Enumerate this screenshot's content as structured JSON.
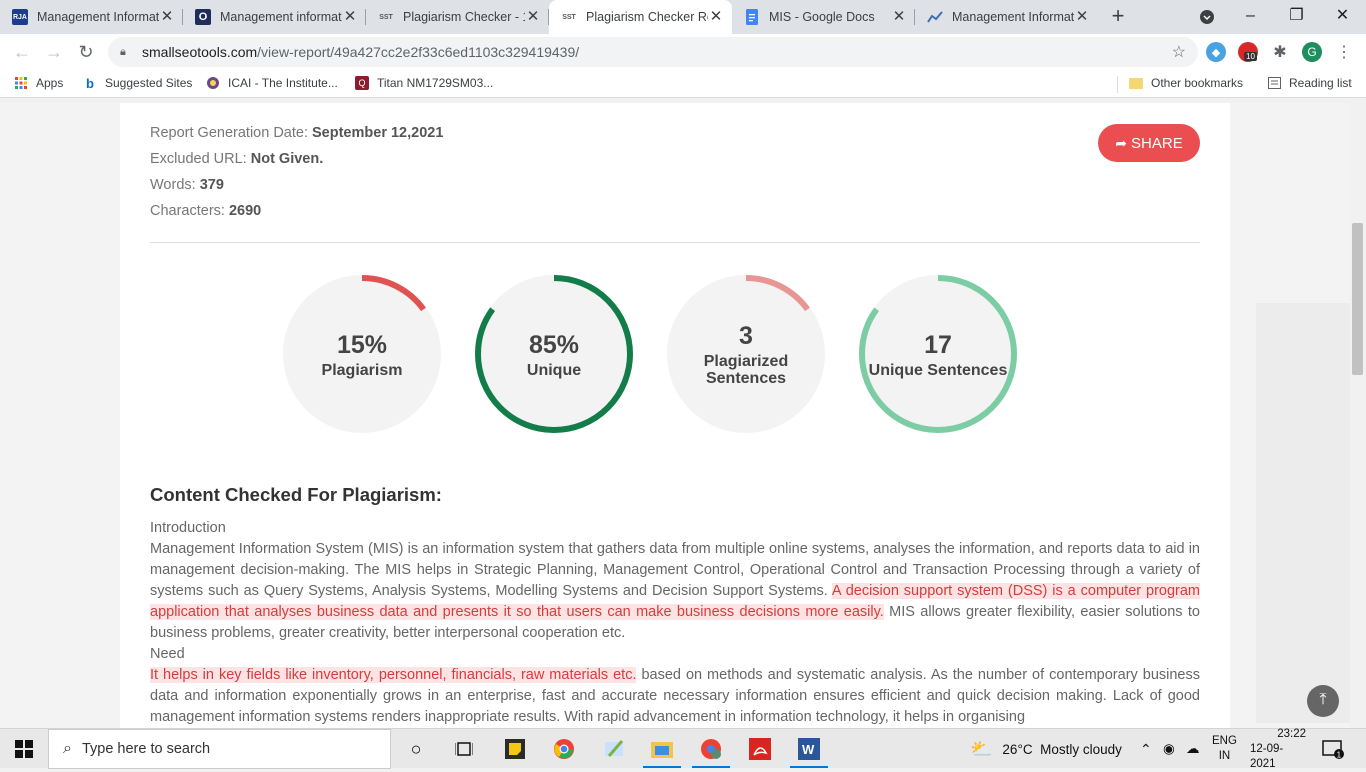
{
  "tabs": [
    {
      "title": "Management Informat",
      "favicon": "RJA",
      "fav_color": "#1c3c8c"
    },
    {
      "title": "Management informat",
      "favicon": "O",
      "fav_color": "#1f2d5a"
    },
    {
      "title": "Plagiarism Checker - 1",
      "favicon": "SST",
      "fav_color": "#ffffff"
    },
    {
      "title": "Plagiarism Checker Re",
      "favicon": "SST",
      "fav_color": "#ffffff"
    },
    {
      "title": "MIS - Google Docs",
      "favicon": "docs-icon",
      "fav_color": "#4285f4"
    },
    {
      "title": "Management Informat",
      "favicon": "chart-icon",
      "fav_color": "#ffffff"
    }
  ],
  "toolbar": {
    "url_host": "smallseotools.com",
    "url_path": "/view-report/49a427cc2e2f33c6ed1103c329419439/"
  },
  "extensions": {
    "badge": "10",
    "profile": "G"
  },
  "bookmarks": {
    "apps": "Apps",
    "suggested": "Suggested Sites",
    "icai": "ICAI - The Institute...",
    "titan": "Titan NM1729SM03...",
    "other": "Other bookmarks",
    "reading": "Reading list"
  },
  "report": {
    "date_label": "Report Generation Date:",
    "date_value": "September 12,2021",
    "url_label": "Excluded URL:",
    "url_value": "Not Given.",
    "words_label": "Words:",
    "words_value": "379",
    "chars_label": "Characters:",
    "chars_value": "2690",
    "share": "SHARE"
  },
  "stats": [
    {
      "value": "15%",
      "label": "Plagiarism",
      "fraction": 0.15,
      "color": "#e05353"
    },
    {
      "value": "85%",
      "label": "Unique",
      "fraction": 0.85,
      "color": "#137d4a"
    },
    {
      "value": "3",
      "label": "Plagiarized Sentences",
      "fraction": 0.15,
      "color": "#e89595"
    },
    {
      "value": "17",
      "label": "Unique Sentences",
      "fraction": 0.85,
      "color": "#7ccca4"
    }
  ],
  "content": {
    "heading": "Content Checked For Plagiarism:",
    "intro_heading": "Introduction",
    "p1_a": "Management Information System (MIS) is an information system that gathers data from multiple online systems, analyses the information, and reports data to aid in management decision-making. The MIS helps in Strategic Planning, Management Control, Operational Control and Transaction Processing through a variety of systems such as Query Systems, Analysis Systems, Modelling Systems and Decision Support Systems. ",
    "p1_hl": "A decision support system (DSS) is a computer program application that analyses business data and presents it so that users can make business decisions more easily.",
    "p1_b": " MIS allows greater flexibility, easier solutions to business problems, greater creativity, better interpersonal cooperation etc.",
    "need_heading": "Need",
    "p2_hl": "It helps in key fields like inventory, personnel, financials, raw materials etc.",
    "p2_b": " based on methods and systematic analysis. As the number of contemporary business data and information exponentially grows in an enterprise, fast and accurate necessary information ensures efficient and quick decision making. Lack of good management information systems renders inappropriate results. With rapid advancement in information technology, it helps in organising"
  },
  "taskbar": {
    "search_placeholder": "Type here to search",
    "temp": "26°C",
    "weather": "Mostly cloudy",
    "lang1": "ENG",
    "lang2": "IN",
    "time": "23:22",
    "date": "12-09-2021",
    "notif_count": "1"
  }
}
